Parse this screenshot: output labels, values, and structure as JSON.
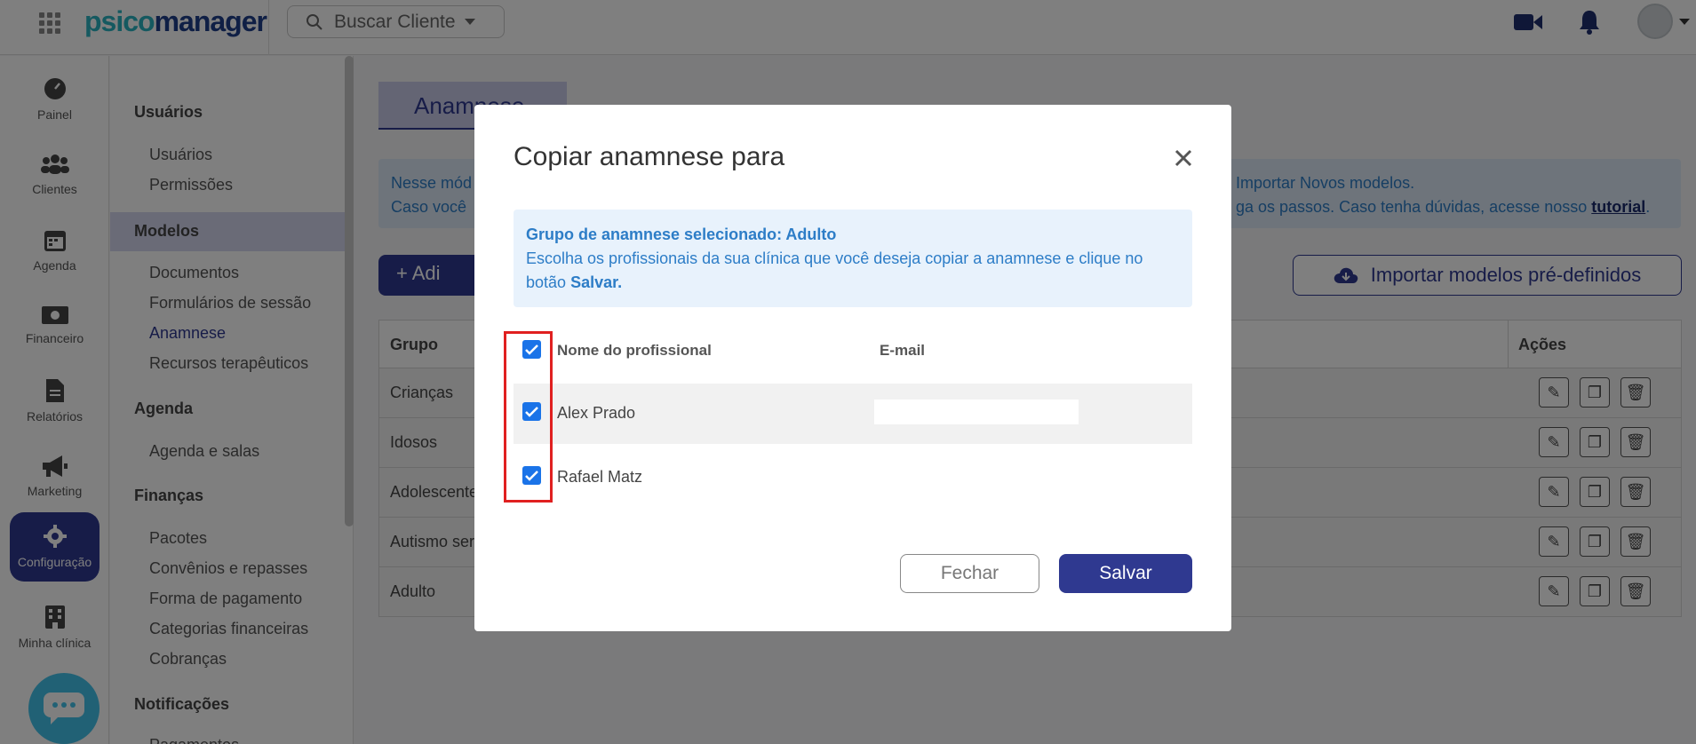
{
  "header": {
    "logo_part1": "psico",
    "logo_part2": "manager",
    "search_placeholder": "Buscar Cliente"
  },
  "rail": [
    {
      "label": "Painel",
      "icon": "dashboard-icon"
    },
    {
      "label": "Clientes",
      "icon": "users-icon"
    },
    {
      "label": "Agenda",
      "icon": "calendar-icon"
    },
    {
      "label": "Financeiro",
      "icon": "money-icon"
    },
    {
      "label": "Relatórios",
      "icon": "report-icon"
    },
    {
      "label": "Marketing",
      "icon": "megaphone-icon"
    },
    {
      "label": "Configuração",
      "icon": "gear-icon",
      "active": true
    },
    {
      "label": "Minha clínica",
      "icon": "building-icon"
    }
  ],
  "sidebar": {
    "sections": [
      {
        "title": "Usuários",
        "items": [
          "Usuários",
          "Permissões"
        ]
      },
      {
        "title": "Modelos",
        "items": [
          "Documentos",
          "Formulários de sessão",
          "Anamnese",
          "Recursos terapêuticos"
        ]
      },
      {
        "title": "Agenda",
        "items": [
          "Agenda e salas"
        ]
      },
      {
        "title": "Finanças",
        "items": [
          "Pacotes",
          "Convênios e repasses",
          "Forma de pagamento",
          "Categorias financeiras",
          "Cobranças"
        ]
      },
      {
        "title": "Notificações",
        "items": [
          "Pagamentos"
        ]
      }
    ]
  },
  "main": {
    "tab_label": "Anamnese",
    "info_line1_left": "Nesse mód",
    "info_line1_right": "Importar Novos modelos.",
    "info_line2_left": "Caso você",
    "info_line2_right": "ga os passos. Caso tenha dúvidas, acesse nosso",
    "info_link": "tutorial",
    "info_period": ".",
    "add_button": "Adi",
    "import_button": "Importar modelos pré-definidos",
    "table": {
      "col_group": "Grupo",
      "col_actions": "Ações",
      "rows": [
        "Crianças",
        "Idosos",
        "Adolescente",
        "Autismo ser",
        "Adulto"
      ]
    }
  },
  "modal": {
    "title": "Copiar anamnese para",
    "notice_bold": "Grupo de anamnese selecionado: Adulto",
    "notice_text": "Escolha os profissionais da sua clínica que você deseja copiar a anamnese e clique no botão",
    "notice_save": "Salvar.",
    "col_name": "Nome do profissional",
    "col_email": "E-mail",
    "professionals": [
      {
        "name": "Alex Prado",
        "checked": true
      },
      {
        "name": "Rafael Matz",
        "checked": true
      }
    ],
    "close_button": "Fechar",
    "save_button": "Salvar"
  },
  "colors": {
    "primary": "#2f3990",
    "info_text": "#2d7dc7",
    "checkbox": "#1a73e8",
    "highlight": "#e02020"
  }
}
